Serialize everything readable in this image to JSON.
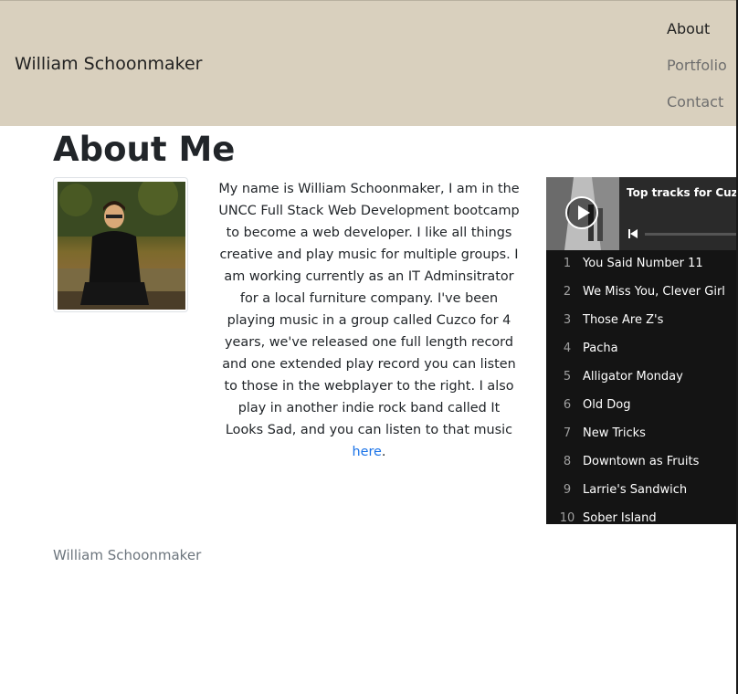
{
  "navbar": {
    "brand": "William Schoonmaker",
    "links": [
      {
        "label": "About",
        "active": true
      },
      {
        "label": "Portfolio",
        "active": false
      },
      {
        "label": "Contact",
        "active": false
      }
    ],
    "background": "#d9d0be"
  },
  "main": {
    "heading": "About Me",
    "bio_text": "My name is William Schoonmaker, I am in the UNCC Full Stack Web Development bootcamp to become a web developer. I like all things creative and play music for multiple groups. I am working currently as an IT Adminsitrator for a local furniture company. I've been playing music in a group called Cuzco for 4 years, we've released one full length record and one extended play record you can listen to those in the webplayer to the right. I also play in another indie rock band called It Looks Sad, and you can listen to that music ",
    "bio_link": "here",
    "bio_end": "."
  },
  "player": {
    "title": "Top tracks for Cuzco",
    "tracks": [
      {
        "num": "1",
        "name": "You Said Number 11"
      },
      {
        "num": "2",
        "name": "We Miss You, Clever Girl"
      },
      {
        "num": "3",
        "name": "Those Are Z's"
      },
      {
        "num": "4",
        "name": "Pacha"
      },
      {
        "num": "5",
        "name": "Alligator Monday"
      },
      {
        "num": "6",
        "name": "Old Dog"
      },
      {
        "num": "7",
        "name": "New Tricks"
      },
      {
        "num": "8",
        "name": "Downtown as Fruits"
      },
      {
        "num": "9",
        "name": "Larrie's Sandwich"
      },
      {
        "num": "10",
        "name": "Sober Island"
      }
    ]
  },
  "footer": {
    "text": "William Schoonmaker"
  }
}
